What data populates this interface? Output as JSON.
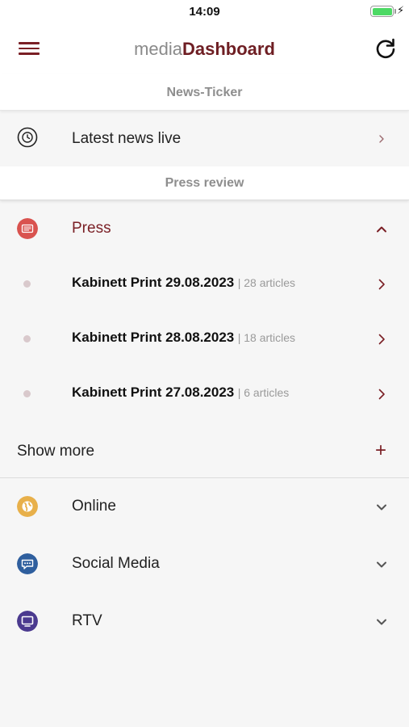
{
  "status_bar": {
    "time": "14:09",
    "battery_level": 1.0
  },
  "header": {
    "brand_light": "media",
    "brand_bold": "Dashboard"
  },
  "news_ticker": {
    "title": "News-Ticker",
    "live_label": "Latest news live"
  },
  "press_review": {
    "title": "Press review",
    "categories": {
      "press": {
        "label": "Press",
        "icon": "newspaper-icon",
        "color": "#d9534f"
      },
      "online": {
        "label": "Online",
        "icon": "globe-icon",
        "color": "#e8b04a"
      },
      "social": {
        "label": "Social Media",
        "icon": "chat-icon",
        "color": "#2f5f9e"
      },
      "rtv": {
        "label": "RTV",
        "icon": "tv-icon",
        "color": "#4b3a8f"
      }
    },
    "press_items": [
      {
        "title": "Kabinett Print 29.08.2023",
        "meta": "| 28 articles"
      },
      {
        "title": "Kabinett Print 28.08.2023",
        "meta": "| 18 articles"
      },
      {
        "title": "Kabinett Print 27.08.2023",
        "meta": "| 6 articles"
      }
    ],
    "show_more": "Show more",
    "show_more_icon": "+"
  },
  "colors": {
    "accent": "#7a1f25",
    "brand": "#6e1e23",
    "muted": "#8e8e8e"
  }
}
